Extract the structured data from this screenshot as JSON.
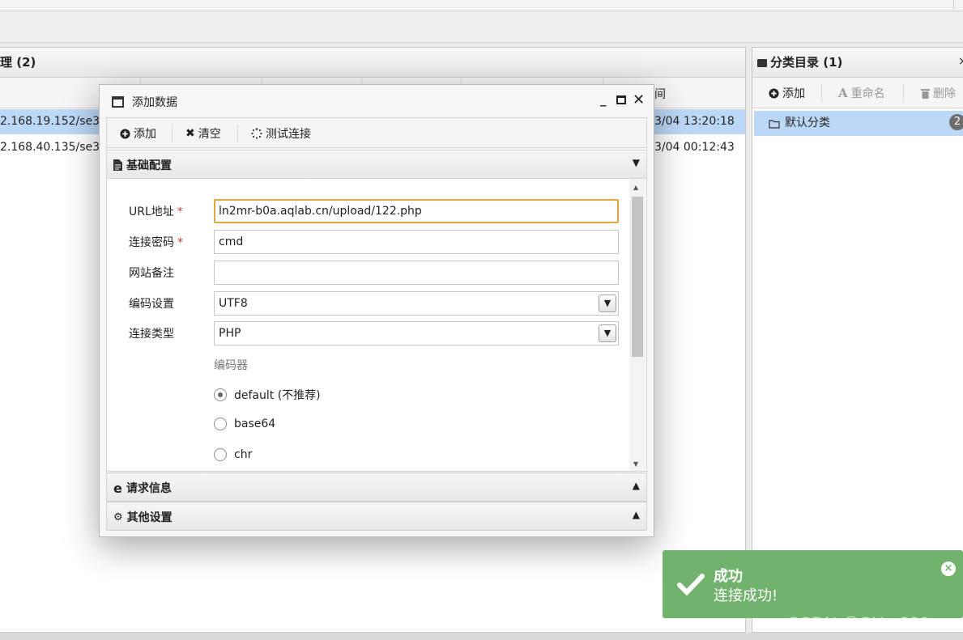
{
  "left_panel": {
    "title": "理 (2)",
    "column_time_label": "间",
    "rows": [
      {
        "url": "2.168.19.152/se3",
        "time": "3/04 13:20:18"
      },
      {
        "url": "2.168.40.135/se3",
        "time": "3/04 00:12:43"
      }
    ]
  },
  "right_panel": {
    "title": "分类目录 (1)",
    "close": "×",
    "toolbar": {
      "add": "添加",
      "rename": "重命名",
      "delete": "删除"
    },
    "tree": [
      {
        "label": "默认分类",
        "count": "2"
      }
    ]
  },
  "dialog": {
    "title": "添加数据",
    "toolbar": {
      "add": "添加",
      "clear": "清空",
      "test": "测试连接"
    },
    "section_basic": "基础配置",
    "section_request": "请求信息",
    "section_other": "其他设置",
    "form": {
      "url_label": "URL地址",
      "url_value": "ln2mr-b0a.aqlab.cn/upload/122.php",
      "password_label": "连接密码",
      "password_value": "cmd",
      "note_label": "网站备注",
      "note_value": "",
      "encoding_label": "编码设置",
      "encoding_value": "UTF8",
      "type_label": "连接类型",
      "type_value": "PHP",
      "encoder_title": "编码器",
      "encoders": [
        {
          "label": "default (不推荐)",
          "selected": true
        },
        {
          "label": "base64",
          "selected": false
        },
        {
          "label": "chr",
          "selected": false
        }
      ],
      "required_mark": "*"
    }
  },
  "toast": {
    "title": "成功",
    "message": "连接成功!",
    "close": "×",
    "color": "#71b36d"
  },
  "watermark": "CSDN @SH . 336"
}
